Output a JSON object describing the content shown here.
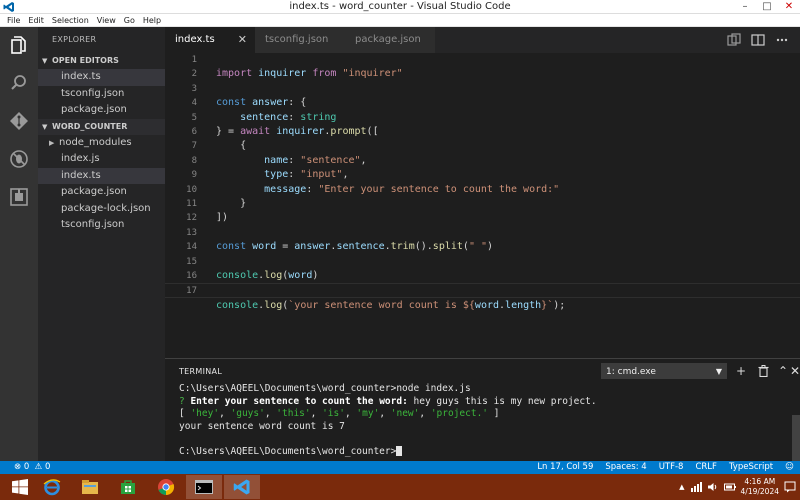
{
  "window": {
    "title": "index.ts - word_counter - Visual Studio Code",
    "min": "–",
    "max": "□",
    "close": "✕"
  },
  "menu": [
    "File",
    "Edit",
    "Selection",
    "View",
    "Go",
    "Help"
  ],
  "sidebar": {
    "header": "EXPLORER",
    "open_editors_label": "OPEN EDITORS",
    "open_editors": [
      "index.ts",
      "tsconfig.json",
      "package.json"
    ],
    "project_label": "WORD_COUNTER",
    "files": [
      "node_modules",
      "index.js",
      "index.ts",
      "package.json",
      "package-lock.json",
      "tsconfig.json"
    ]
  },
  "tabs": [
    {
      "label": "index.ts",
      "close": "✕"
    },
    {
      "label": "tsconfig.json"
    },
    {
      "label": "package.json"
    }
  ],
  "editor": {
    "line_numbers": [
      "1",
      "2",
      "3",
      "4",
      "5",
      "6",
      "7",
      "8",
      "9",
      "10",
      "11",
      "12",
      "13",
      "14",
      "15",
      "16",
      "17"
    ],
    "lines": {
      "l1": [
        "import",
        " inquirer ",
        "from",
        " \"inquirer\""
      ],
      "l3": [
        "const",
        " answer",
        ": {"
      ],
      "l4": [
        "    sentence",
        ": ",
        "string"
      ],
      "l5": [
        "} = ",
        "await",
        " inquirer",
        ".",
        "prompt",
        "(["
      ],
      "l6": [
        "    {"
      ],
      "l7": [
        "        name",
        ": ",
        "\"sentence\"",
        ","
      ],
      "l8": [
        "        type",
        ": ",
        "\"input\"",
        ","
      ],
      "l9": [
        "        message",
        ": ",
        "\"Enter your sentence to count the word:\""
      ],
      "l10": [
        "    }"
      ],
      "l11": [
        "])"
      ],
      "l13": [
        "const",
        " word",
        " = ",
        "answer",
        ".",
        "sentence",
        ".",
        "trim",
        "().",
        "split",
        "(",
        "\" \"",
        ")"
      ],
      "l15": [
        "console",
        ".",
        "log",
        "(",
        "word",
        ")"
      ],
      "l17": [
        "console",
        ".",
        "log",
        "(",
        "`your sentence word count is ${",
        "word",
        ".",
        "length",
        "}`",
        ");"
      ]
    }
  },
  "terminal": {
    "title": "TERMINAL",
    "shell": "1: cmd.exe",
    "add": "+",
    "trash": "🗑",
    "caret_up": "⌃",
    "close": "✕",
    "lines": {
      "cmd": "C:\\Users\\AQEEL\\Documents\\word_counter>node index.js",
      "q_mark": "?",
      "q_text": " Enter your sentence to count the word:",
      "q_answer": " hey guys this is my new project.",
      "arr_open": "[ ",
      "arr_items": [
        "'hey'",
        "'guys'",
        "'this'",
        "'is'",
        "'my'",
        "'new'",
        "'project.'"
      ],
      "arr_sep": ", ",
      "arr_close": " ]",
      "result": "your sentence word count is 7",
      "prompt": "C:\\Users\\AQEEL\\Documents\\word_counter>"
    }
  },
  "status": {
    "errors": "⊗ 0",
    "warnings": "⚠ 0",
    "position": "Ln 17, Col 59",
    "spaces": "Spaces: 4",
    "encoding": "UTF-8",
    "eol": "CRLF",
    "language": "TypeScript",
    "smiley": "☺"
  },
  "taskbar": {
    "time": "4:16 AM",
    "date": "4/19/2024",
    "tray_up": "▲"
  },
  "colors": {
    "accent": "#007acc",
    "taskbar": "#7a2a0c"
  }
}
